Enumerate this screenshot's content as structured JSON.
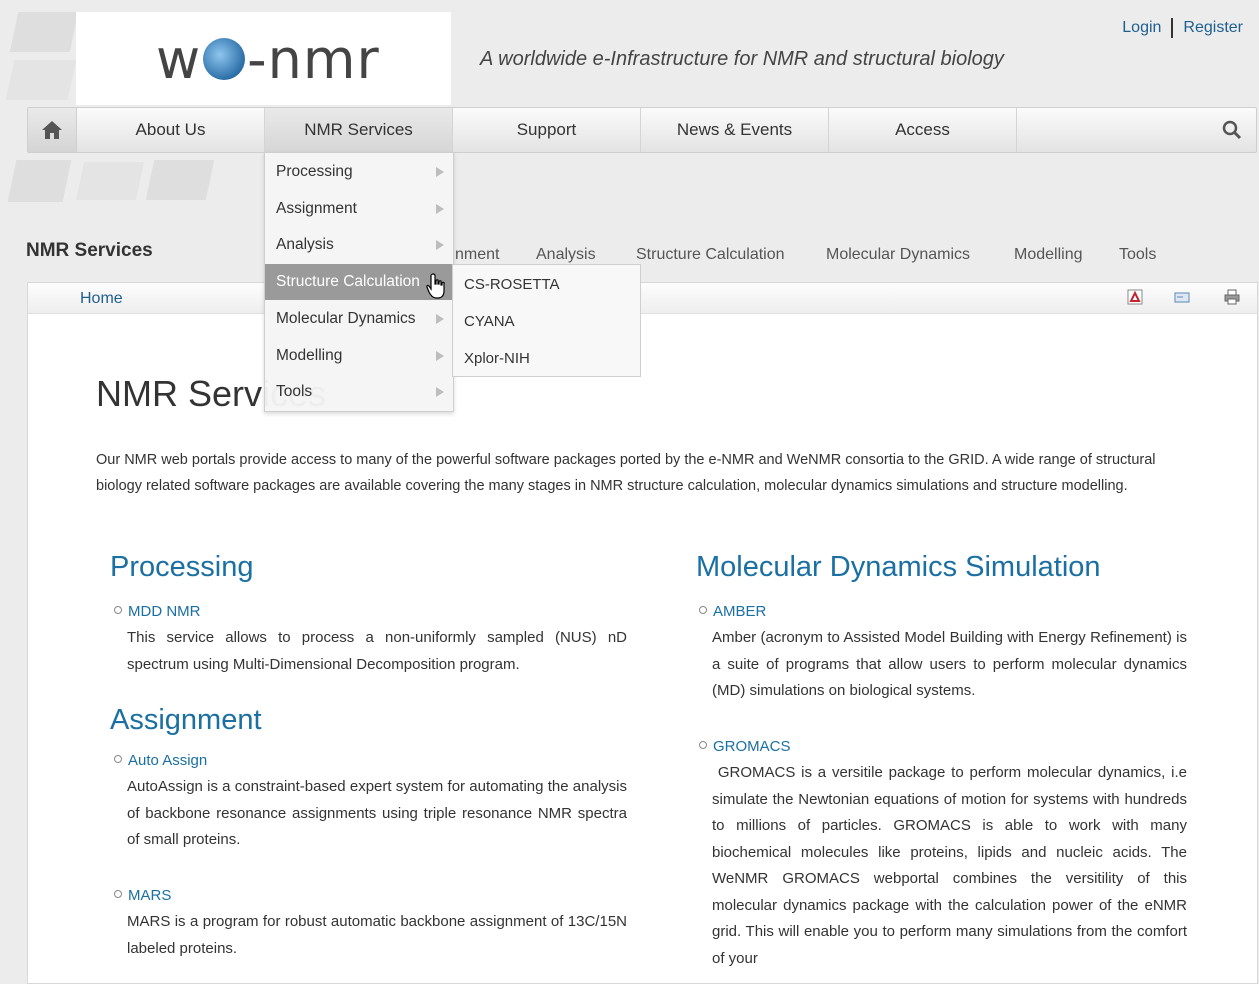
{
  "header": {
    "logo_text_left": "w",
    "logo_text_right": "-nmr",
    "tagline": "A worldwide e-Infrastructure for NMR and structural biology",
    "login": "Login",
    "register": "Register"
  },
  "nav": {
    "items": [
      {
        "label": "About Us"
      },
      {
        "label": "NMR Services"
      },
      {
        "label": "Support"
      },
      {
        "label": "News & Events"
      },
      {
        "label": "Access"
      }
    ],
    "home_icon": "home-icon",
    "search_icon": "search-icon"
  },
  "dropdown": {
    "items": [
      {
        "label": "Processing"
      },
      {
        "label": "Assignment"
      },
      {
        "label": "Analysis"
      },
      {
        "label": "Structure Calculation"
      },
      {
        "label": "Molecular Dynamics"
      },
      {
        "label": "Modelling"
      },
      {
        "label": "Tools"
      }
    ],
    "submenu": [
      {
        "label": "CS-ROSETTA"
      },
      {
        "label": "CYANA"
      },
      {
        "label": "Xplor-NIH"
      }
    ]
  },
  "section": {
    "title": "NMR Services",
    "subnav": [
      "nment",
      "Analysis",
      "Structure Calculation",
      "Molecular Dynamics",
      "Modelling",
      "Tools"
    ]
  },
  "breadcrumb": {
    "home": "Home"
  },
  "page": {
    "title": "NMR Services",
    "intro": "Our NMR web portals provide access to many of the powerful software packages ported by the e-NMR and WeNMR consortia to the GRID. A wide range of structural biology related software packages are available covering the many stages in NMR structure calculation, molecular dynamics simulations and structure modelling."
  },
  "left": {
    "processing_title": "Processing",
    "mdd_link": "MDD NMR",
    "mdd_desc": "This service allows to process a non-uniformly sampled (NUS) nD spectrum using Multi-Dimensional Decomposition program.",
    "assignment_title": "Assignment",
    "autoassign_link": "Auto Assign",
    "autoassign_desc": "AutoAssign is a constraint-based expert system for automating the analysis of backbone resonance assignments using triple resonance NMR spectra of small proteins.",
    "mars_link": "MARS",
    "mars_desc": "MARS is a program for robust automatic backbone assignment of 13C/15N labeled proteins."
  },
  "right": {
    "md_title": "Molecular Dynamics Simulation",
    "amber_link": "AMBER",
    "amber_desc": "Amber (acronym to Assisted Model Building with Energy Refinement) is a suite of programs that allow users to perform molecular dynamics (MD) simulations on biological systems.",
    "gromacs_link": "GROMACS",
    "gromacs_desc": " GROMACS is a versitile package to perform molecular dynamics, i.e simulate the Newtonian equations of motion for systems with hundreds to millions of particles. GROMACS is able to work with many biochemical molecules like proteins, lipids and nucleic acids. The WeNMR GROMACS webportal combines the versitility of this molecular dynamics package with the calculation power of the eNMR grid. This will enable you to perform many simulations from the comfort of your"
  }
}
